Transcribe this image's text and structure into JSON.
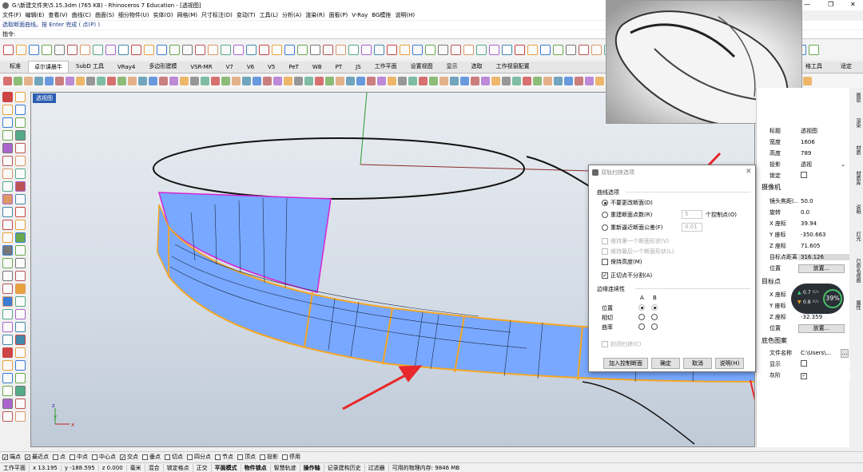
{
  "titlebar": {
    "title": "G:\\新建文件夹\\5.15.3dm (765 KB) - Rhinoceros 7 Education - [透视图]",
    "window_buttons": [
      "—",
      "❐",
      "✕"
    ]
  },
  "menu": [
    "文件(F)",
    "编辑(E)",
    "查看(V)",
    "曲线(C)",
    "曲面(S)",
    "细分物件(U)",
    "实体(O)",
    "网格(M)",
    "尺寸标注(D)",
    "变动(T)",
    "工具(L)",
    "分析(A)",
    "渲染(R)",
    "面板(P)",
    "V-Ray",
    "BG模挫",
    "说明(H)"
  ],
  "command": {
    "history": "选取断面曲线。按 Enter 完成 ( 点(P) )",
    "prompt": "指令:"
  },
  "tabs": [
    "标准",
    "卓尔课晨牛",
    "SubD 工具",
    "VRay4",
    "多边形建模",
    "VSR-MR",
    "V7",
    "V6",
    "V5",
    "PeT",
    "WB",
    "PT",
    "JS",
    "工作平面",
    "设置视图",
    "显示",
    "选取",
    "工作视窗配置"
  ],
  "tabs_right": [
    "格工具",
    "适定"
  ],
  "viewport": {
    "label": "透视图"
  },
  "properties": {
    "rows_top": [
      {
        "key": "标题",
        "value": "透视图"
      },
      {
        "key": "宽度",
        "value": "1606"
      },
      {
        "key": "高度",
        "value": "789"
      },
      {
        "key": "投影",
        "value": "透视"
      },
      {
        "key": "锁定",
        "value": ""
      }
    ],
    "camera_title": "摄像机",
    "camera_rows": [
      {
        "key": "镜头焦距(...",
        "value": "50.0"
      },
      {
        "key": "旋转",
        "value": "0.0"
      },
      {
        "key": "X 座标",
        "value": "39.94"
      },
      {
        "key": "Y 座标",
        "value": "-350.663"
      },
      {
        "key": "Z 座标",
        "value": "71.605"
      },
      {
        "key": "目标点距离",
        "value": "316.126"
      },
      {
        "key": "位置",
        "value": "放置..."
      }
    ],
    "target_title": "目标点",
    "target_rows": [
      {
        "key": "X 座标",
        "value": ""
      },
      {
        "key": "Y 座标",
        "value": ""
      },
      {
        "key": "Z 座标",
        "value": "-32.359"
      },
      {
        "key": "位置",
        "value": "放置..."
      }
    ],
    "bg_title": "底色图案",
    "bg_rows": [
      {
        "key": "文件名称",
        "value": "C:\\Users\\..."
      },
      {
        "key": "显示",
        "value": ""
      },
      {
        "key": "灰阶",
        "value": ""
      }
    ]
  },
  "right_tabs": [
    "图层",
    "渲染",
    "材质",
    "材质库",
    "说明",
    "灯光",
    "已命名视图",
    "属性"
  ],
  "gauge": {
    "percent": "39%",
    "up": "0.7",
    "down": "0.8",
    "unit": "K/s"
  },
  "dialog": {
    "title": "双轨扫掠选项",
    "section_curve": "曲线选项",
    "opt_nochange": "不要更改断面(D)",
    "opt_rebuild": "重建断面点数(R)",
    "rebuild_value": "5",
    "rebuild_unit": "个控制点(O)",
    "opt_refit": "重新逼近断面公差(F)",
    "refit_value": "0.01",
    "chk_keep_first": "维持第一个断面形状(V)",
    "chk_keep_last": "维持最后一个断面形状(L)",
    "chk_keep_height": "保持高度(M)",
    "chk_tangent": "正切点不分割(A)",
    "section_edge": "边缘连续性",
    "col_a": "A",
    "col_b": "B",
    "edge_rows": [
      "位置",
      "相切",
      "曲率"
    ],
    "chk_closed": "封闭扫掠(C)",
    "btn_add": "加入控制断面",
    "btn_ok": "确定",
    "btn_cancel": "取消",
    "btn_help": "说明(H)"
  },
  "osnap": {
    "items": [
      "端点",
      "最近点",
      "点",
      "中点",
      "中心点",
      "交点",
      "垂点",
      "切点",
      "四分点",
      "节点",
      "顶点",
      "投影",
      "停用"
    ],
    "checked": [
      true,
      true,
      false,
      false,
      false,
      true,
      false,
      false,
      false,
      false,
      false,
      false,
      false
    ]
  },
  "status": {
    "cplane": "工作平面",
    "x": "x 13.195",
    "y": "y -188.595",
    "z": "z 0.000",
    "unit": "毫米",
    "layer": "混合",
    "items": [
      "锁定格点",
      "正交",
      "平面模式",
      "物件锁点",
      "智慧轨迹",
      "操作轴",
      "记录建构历史",
      "过滤器"
    ],
    "bold": [
      false,
      false,
      true,
      true,
      false,
      true,
      false,
      false
    ],
    "memory": "可用的物理内存: 9846 MB"
  },
  "colors": {
    "surface_blue": "#78a8ff",
    "edge_orange": "#f5a623",
    "edge_magenta": "#d624d6",
    "arrow_red": "#e8282b",
    "axis_green": "#2a9a2a"
  }
}
